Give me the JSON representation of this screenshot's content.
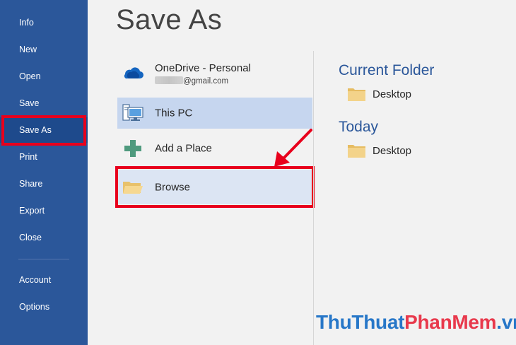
{
  "sidebar": {
    "items": [
      {
        "label": "Info"
      },
      {
        "label": "New"
      },
      {
        "label": "Open"
      },
      {
        "label": "Save"
      },
      {
        "label": "Save As"
      },
      {
        "label": "Print"
      },
      {
        "label": "Share"
      },
      {
        "label": "Export"
      },
      {
        "label": "Close"
      },
      {
        "label": "Account"
      },
      {
        "label": "Options"
      }
    ],
    "active_item": "Save As"
  },
  "main": {
    "title": "Save As",
    "places": {
      "onedrive": {
        "label": "OneDrive - Personal",
        "email_suffix": "@gmail.com",
        "icon": "cloud-icon"
      },
      "this_pc": {
        "label": "This PC",
        "icon": "computer-icon"
      },
      "add_place": {
        "label": "Add a Place",
        "icon": "plus-icon"
      },
      "browse": {
        "label": "Browse",
        "icon": "folder-open-icon"
      }
    },
    "current_folder": {
      "title": "Current Folder",
      "folder": "Desktop"
    },
    "today": {
      "title": "Today",
      "folder": "Desktop"
    }
  },
  "watermark": {
    "part1": "ThuThuat",
    "part2": "PhanMem",
    "part3": ".vn"
  },
  "colors": {
    "sidebar": "#2b579a",
    "accent": "#2b579a",
    "highlight": "#e8001c",
    "selected": "#c6d6ef",
    "folder": "#f0c974"
  }
}
